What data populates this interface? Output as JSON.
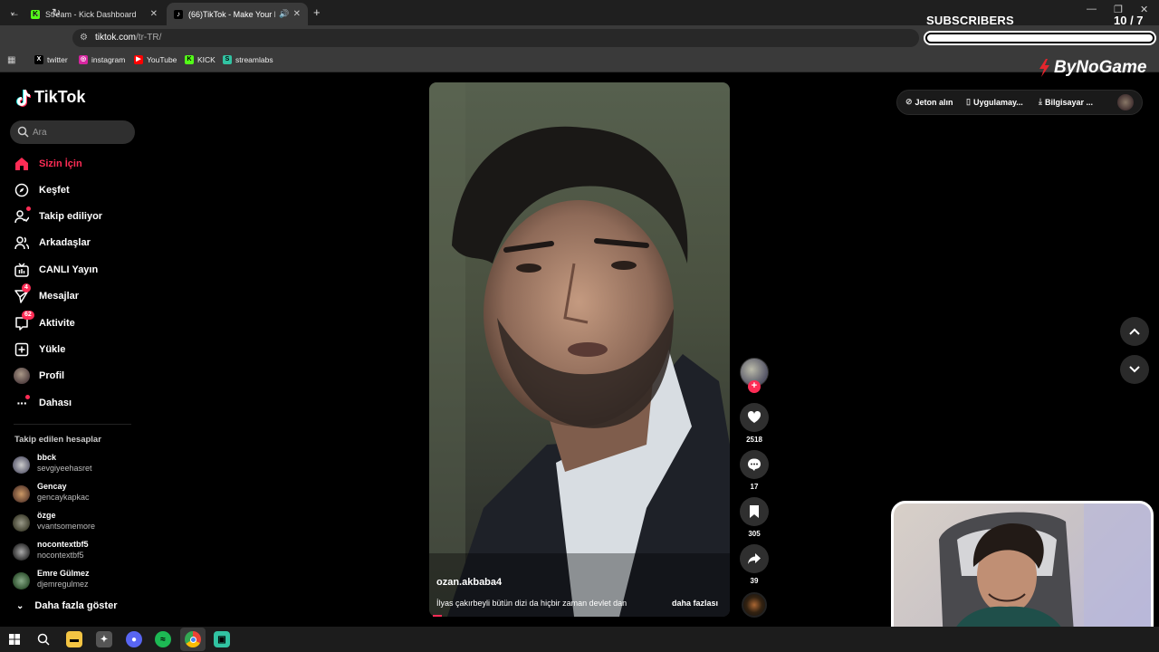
{
  "browser": {
    "tabs": [
      {
        "title": "Stream - Kick Dashboard"
      },
      {
        "title": "(66)TikTok - Make Your Day"
      }
    ],
    "url_host": "tiktok.com",
    "url_path": "/tr-TR/",
    "bookmarks": [
      "twitter",
      "instagram",
      "YouTube",
      "KICK",
      "streamlabs"
    ]
  },
  "tiktok": {
    "logo": "TikTok",
    "search_placeholder": "Ara",
    "nav": [
      {
        "label": "Sizin İçin",
        "icon": "home-icon"
      },
      {
        "label": "Keşfet",
        "icon": "compass-icon"
      },
      {
        "label": "Takip ediliyor",
        "icon": "following-icon"
      },
      {
        "label": "Arkadaşlar",
        "icon": "friends-icon"
      },
      {
        "label": "CANLI Yayın",
        "icon": "live-icon"
      },
      {
        "label": "Mesajlar",
        "icon": "message-icon",
        "badge": "4"
      },
      {
        "label": "Aktivite",
        "icon": "activity-icon",
        "badge": "62"
      },
      {
        "label": "Yükle",
        "icon": "upload-icon"
      },
      {
        "label": "Profil",
        "icon": "profile-avatar"
      },
      {
        "label": "Dahası",
        "icon": "more-icon"
      }
    ],
    "following_title": "Takip edilen hesaplar",
    "following": [
      {
        "name": "bbck",
        "user": "sevgiyeehasret"
      },
      {
        "name": "Gencay",
        "user": "gencaykapkac"
      },
      {
        "name": "özge",
        "user": "vvantsomemore"
      },
      {
        "name": "nocontextbf5",
        "user": "nocontextbf5"
      },
      {
        "name": "Emre Gülmez",
        "user": "djemregulmez"
      }
    ],
    "show_more": "Daha fazla göster",
    "header": {
      "coins": "Jeton alın",
      "app": "Uygulamay...",
      "desktop": "Bilgisayar ..."
    },
    "video": {
      "author": "ozan.akbaba4",
      "caption": "İlyas çakırbeyli bütün dizi da hiçbir zaman devlet dan",
      "more": "daha fazlası",
      "likes": "2518",
      "comments": "17",
      "saves": "305",
      "shares": "39",
      "progress_percent": 3
    }
  },
  "overlay": {
    "subs_label": "SUBSCRIBERS",
    "subs_count": "10  / 7",
    "brand": "ByNoGame"
  },
  "colors": {
    "accent": "#fe2c55"
  }
}
